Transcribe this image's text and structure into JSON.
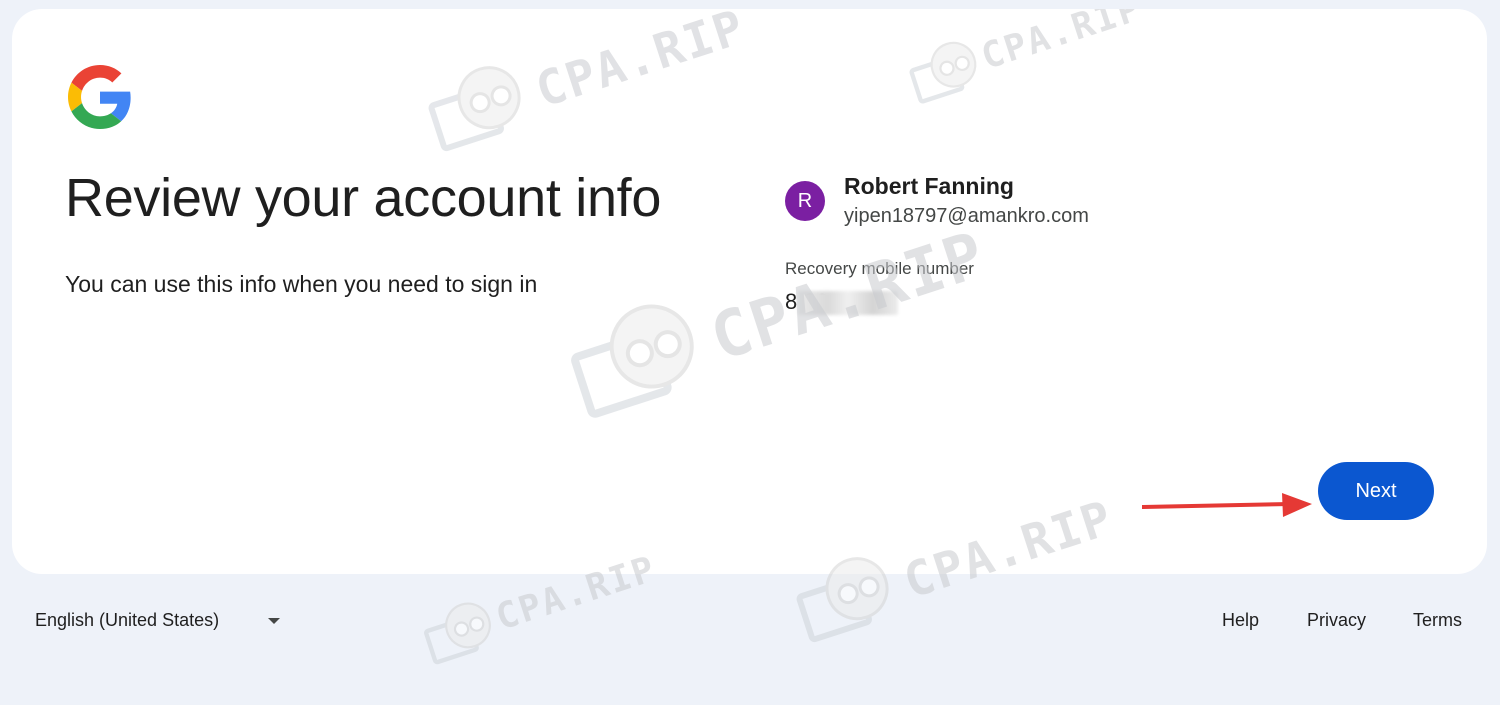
{
  "header": {
    "title": "Review your account info",
    "subtitle": "You can use this info when you need to sign in"
  },
  "account": {
    "avatar_initial": "R",
    "avatar_color": "#7b1fa2",
    "name": "Robert Fanning",
    "email": "yipen18797@amankro.com"
  },
  "recovery": {
    "label": "Recovery mobile number",
    "value": "8 06"
  },
  "actions": {
    "next_label": "Next",
    "accent_color": "#0b57d0"
  },
  "footer": {
    "language": "English (United States)",
    "links": {
      "help": "Help",
      "privacy": "Privacy",
      "terms": "Terms"
    }
  },
  "watermark": {
    "text": "CPA.RIP"
  },
  "icons": {
    "logo": "google-logo",
    "language_dropdown": "caret-down-icon",
    "annotation": "red-arrow"
  }
}
